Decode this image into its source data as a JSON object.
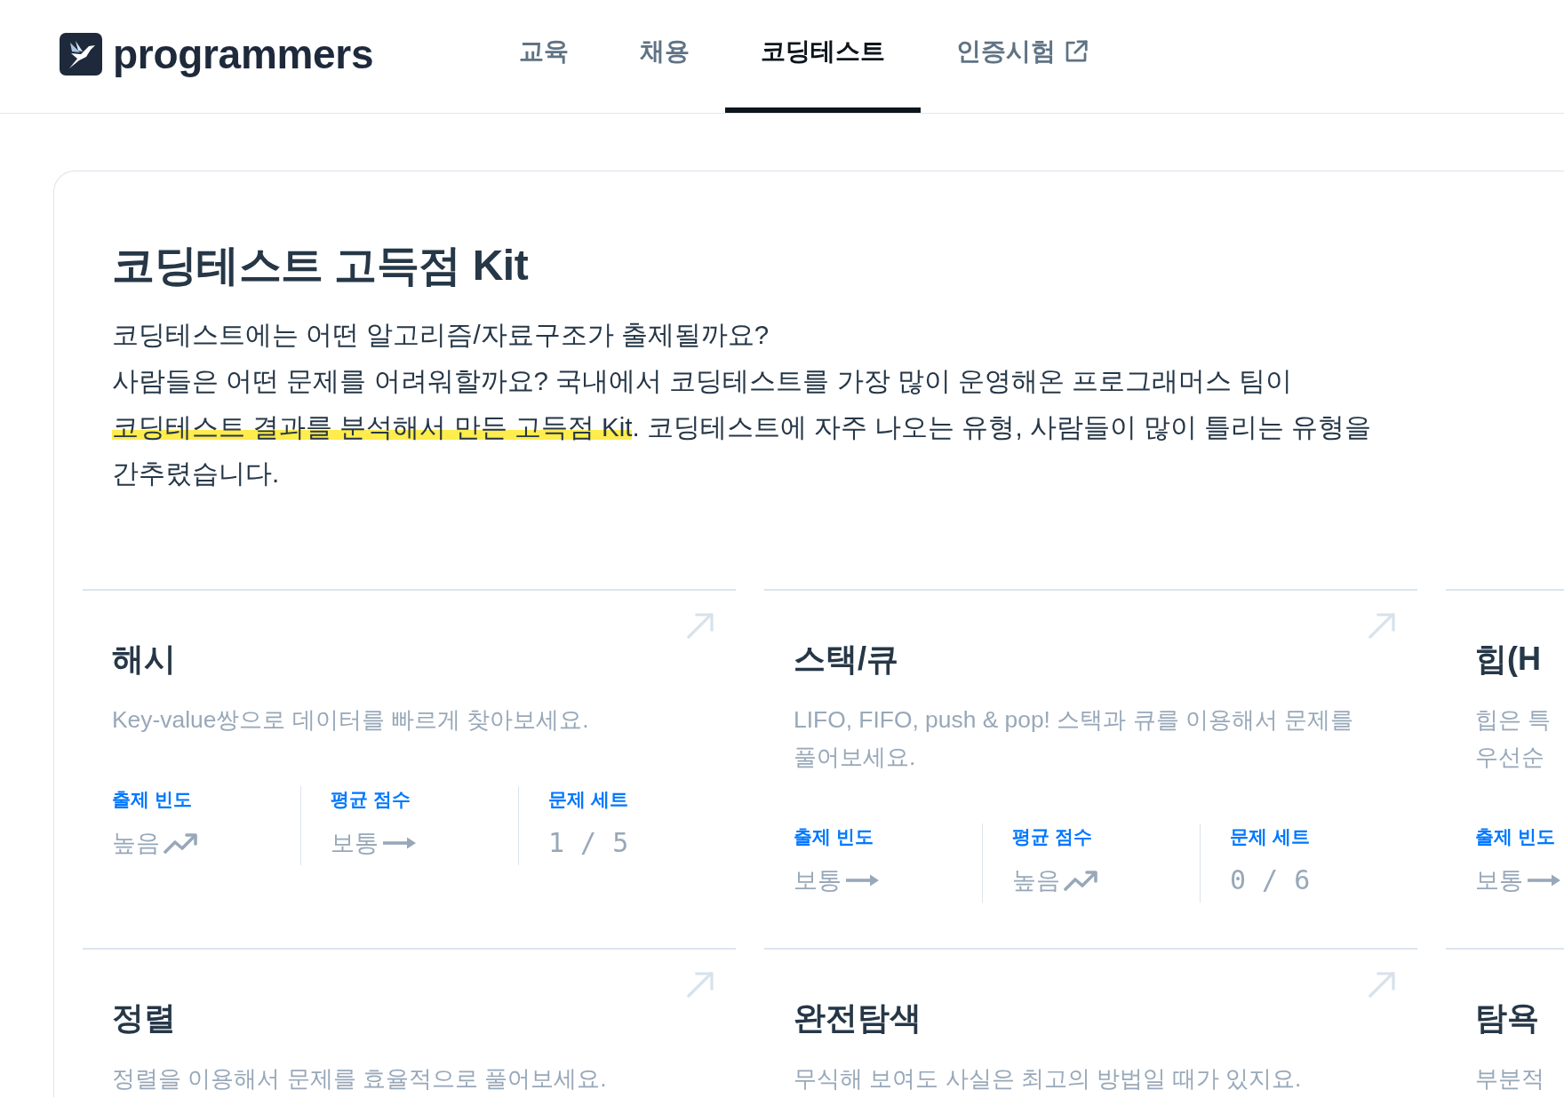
{
  "header": {
    "logo": {
      "text": "programmers"
    },
    "nav": [
      {
        "label": "교육",
        "selected": false,
        "external": false
      },
      {
        "label": "채용",
        "selected": false,
        "external": false
      },
      {
        "label": "코딩테스트",
        "selected": true,
        "external": false
      },
      {
        "label": "인증시험",
        "selected": false,
        "external": true
      }
    ]
  },
  "kit": {
    "title": "코딩테스트 고득점 Kit",
    "intro_lines": [
      [
        {
          "text": "코딩테스트에는 어떤 알고리즘/자료구조가 출제될까요?",
          "highlighted": false
        }
      ],
      [
        {
          "text": "사람들은 어떤 문제를 어려워할까요? 국내에서 코딩테스트를 가장 많이 운영해온 프로그래머스 팀이",
          "highlighted": false
        }
      ],
      [
        {
          "text": "코딩테스트 결과를 분석해서 만든 고득점 Kit",
          "highlighted": true
        },
        {
          "text": ". 코딩테스트에 자주 나오는 유형, 사람들이 많이 틀리는 유형을",
          "highlighted": false
        }
      ],
      [
        {
          "text": "간추렸습니다.",
          "highlighted": false
        }
      ]
    ],
    "cards": [
      {
        "title": "해시",
        "description_lines": [
          "Key-value쌍으로 데이터를 빠르게 찾아보세요."
        ],
        "stats": [
          {
            "label": "출제 빈도",
            "kind": "rising",
            "value": "높음"
          },
          {
            "label": "평균 점수",
            "kind": "steady",
            "value": "보통"
          },
          {
            "label": "문제 세트",
            "kind": "count",
            "value": "1 / 5"
          }
        ]
      },
      {
        "title": "스택/큐",
        "description_lines": [
          "LIFO, FIFO, push & pop! 스택과 큐를 이용해서 문제를",
          "풀어보세요."
        ],
        "stats": [
          {
            "label": "출제 빈도",
            "kind": "steady",
            "value": "보통"
          },
          {
            "label": "평균 점수",
            "kind": "rising",
            "value": "높음"
          },
          {
            "label": "문제 세트",
            "kind": "count",
            "value": "0 / 6"
          }
        ]
      },
      {
        "title": "힙(H",
        "description_lines": [
          "힙은 특",
          "우선순"
        ],
        "stats": [
          {
            "label": "출제 빈도",
            "kind": "steady",
            "value": "보통"
          }
        ]
      },
      {
        "title": "정렬",
        "description_lines": [
          "정렬을 이용해서 문제를 효율적으로 풀어보세요."
        ]
      },
      {
        "title": "완전탐색",
        "description_lines": [
          "무식해 보여도 사실은 최고의 방법일 때가 있지요."
        ]
      },
      {
        "title": "탐욕",
        "description_lines": [
          "부분적"
        ]
      }
    ]
  }
}
